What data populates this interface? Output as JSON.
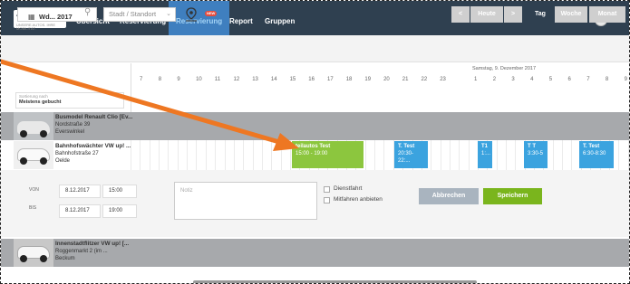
{
  "nav": {
    "logo": "teilautos",
    "logo_sub": "UNSERE AUTOS. IHRE MOBILITÄT.",
    "items": [
      "Übersicht",
      "Reservierung",
      "Reservierung",
      "Report",
      "Gruppen"
    ],
    "badge": "NEW"
  },
  "toolbar": {
    "search_placeholder": "",
    "location_select": "Stadt / Standort",
    "prev": "<",
    "today": "Heute",
    "next": ">",
    "views": [
      "Tag",
      "Woche",
      "Monat"
    ],
    "active_view": "Tag"
  },
  "side": {
    "date": "Wd... 2017",
    "sort_label": "Sortierung nach",
    "sort_value": "Meistens gebucht"
  },
  "timeline": {
    "day_label": "Samstag, 9. Dezember 2017",
    "hours_day1": [
      "7",
      "8",
      "9",
      "10",
      "11",
      "12",
      "13",
      "14",
      "15",
      "16",
      "17",
      "18",
      "19",
      "20",
      "21",
      "22",
      "23"
    ],
    "hours_day2": [
      "1",
      "2",
      "3",
      "4",
      "5",
      "6",
      "7",
      "8",
      "9"
    ]
  },
  "cars": [
    {
      "name": "Busmodel Renault Clio [Ev...",
      "street": "Nordstraße 39",
      "city": "Everswinkel"
    },
    {
      "name": "Bahnhofswächter VW up! ...",
      "street": "Bahnhofstraße 27",
      "city": "Oelde"
    },
    {
      "name": "Innenstadtflitzer VW up! [...",
      "street": "Roggenmarkt 2 (im ...",
      "city": "Beckum"
    }
  ],
  "bookings": [
    {
      "title": "teilautos Test",
      "time": "15:00 - 19:00",
      "color": "green"
    },
    {
      "title": "T. Test",
      "time": "20:30-22:...",
      "color": "blue"
    },
    {
      "title": "T1",
      "time": "1:...",
      "color": "blue"
    },
    {
      "title": "T T",
      "time": "3:30-5",
      "color": "blue"
    },
    {
      "title": "T. Test",
      "time": "6:30-8:30",
      "color": "blue"
    }
  ],
  "form": {
    "von_label": "VON",
    "bis_label": "BIS",
    "von_date": "8.12.2017",
    "von_time": "15:00",
    "bis_date": "8.12.2017",
    "bis_time": "19:00",
    "notiz_placeholder": "Notiz",
    "dienstfahrt": "Dienstfahrt",
    "mitfahren": "Mitfahren anbieten",
    "cancel": "Abbrechen",
    "save": "Speichern"
  },
  "colors": {
    "nav_bg": "#2f4050",
    "active_nav": "#3f7fbf",
    "booking_blue": "#3ba3df",
    "booking_green": "#8cc63e",
    "save_green": "#7ab51d",
    "cancel_gray": "#a9b4bf",
    "arrow_orange": "#ee7722"
  }
}
